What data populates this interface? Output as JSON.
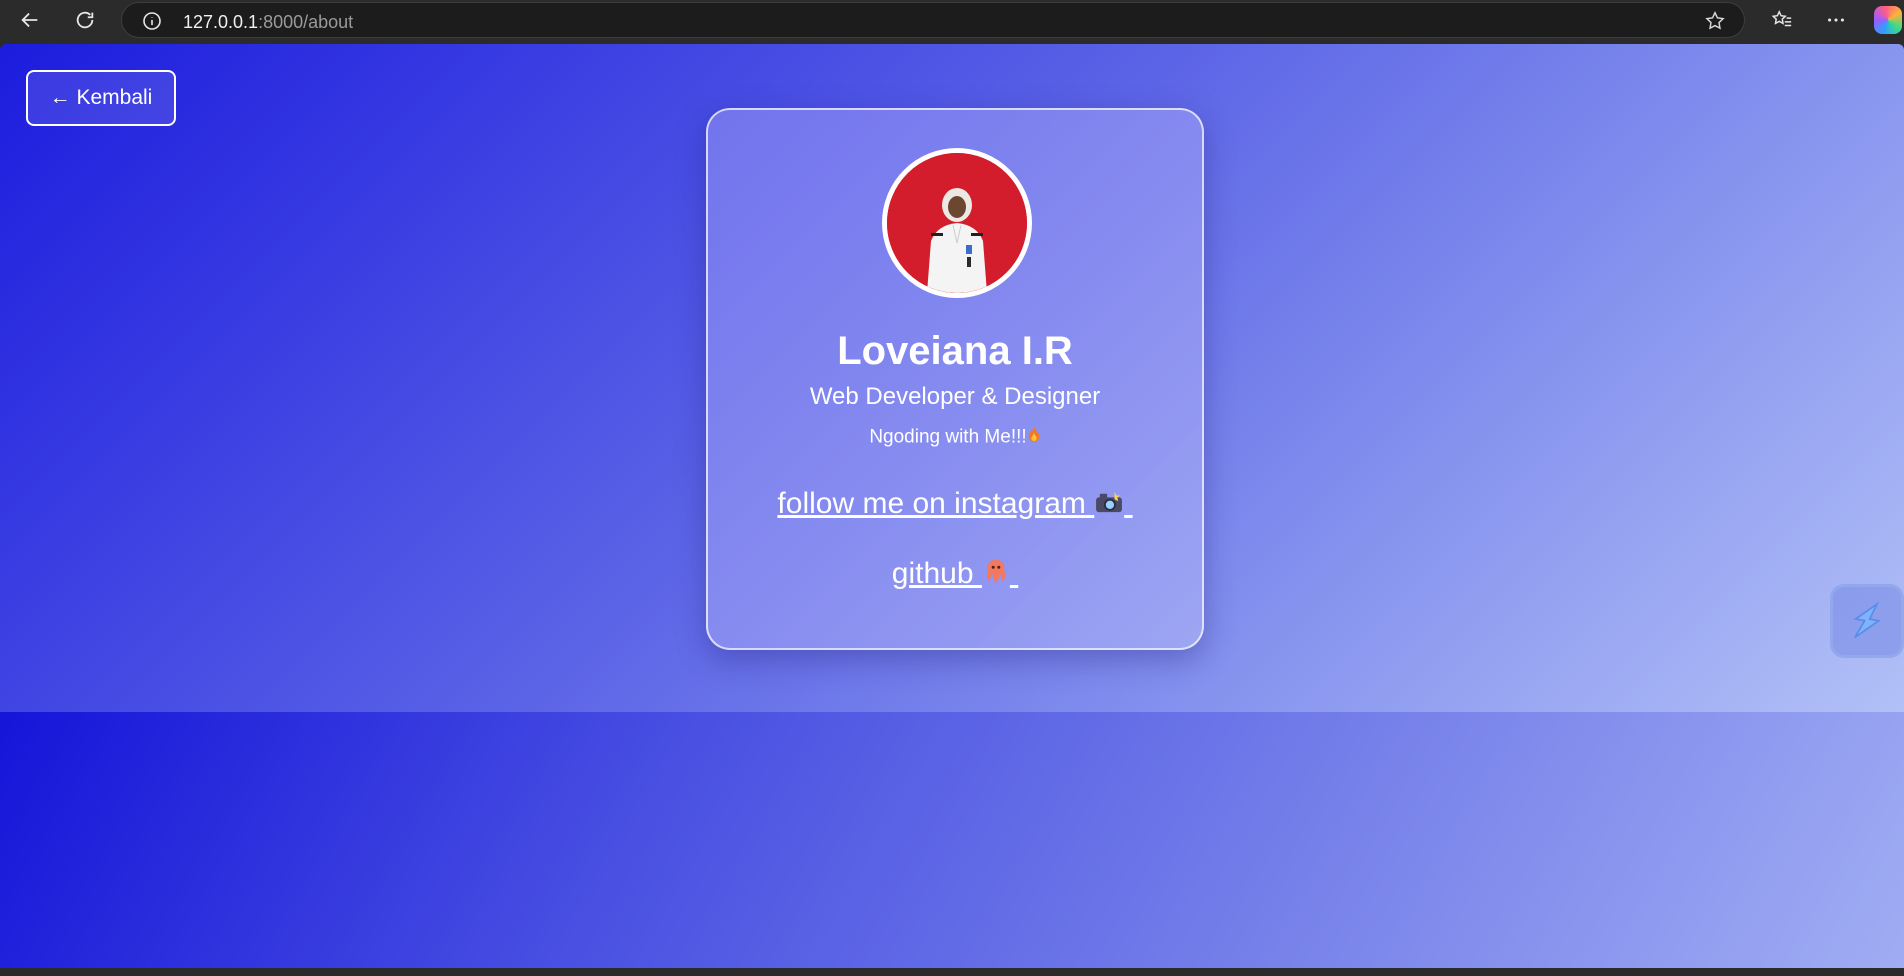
{
  "browser": {
    "url_host": "127.0.0.1",
    "url_path": ":8000/about",
    "icons": [
      "back-arrow-icon",
      "reload-icon",
      "site-info-icon",
      "bookmark-star-icon",
      "favorites-icon",
      "more-menu-icon",
      "copilot-icon"
    ]
  },
  "page": {
    "back_label": "← Kembali",
    "profile": {
      "name": "Loveiana I.R",
      "role": "Web Developer & Designer",
      "tagline": "Ngoding with Me!!!",
      "tagline_emoji": "fire-icon"
    },
    "links": {
      "instagram": "follow me on instagram",
      "instagram_emoji": "camera-icon",
      "github": "github",
      "github_emoji": "octopus-icon"
    },
    "colors": {
      "gradient_start": "#1c1cde",
      "gradient_end": "#b2c0f7",
      "avatar_bg": "#d81e2e"
    }
  }
}
